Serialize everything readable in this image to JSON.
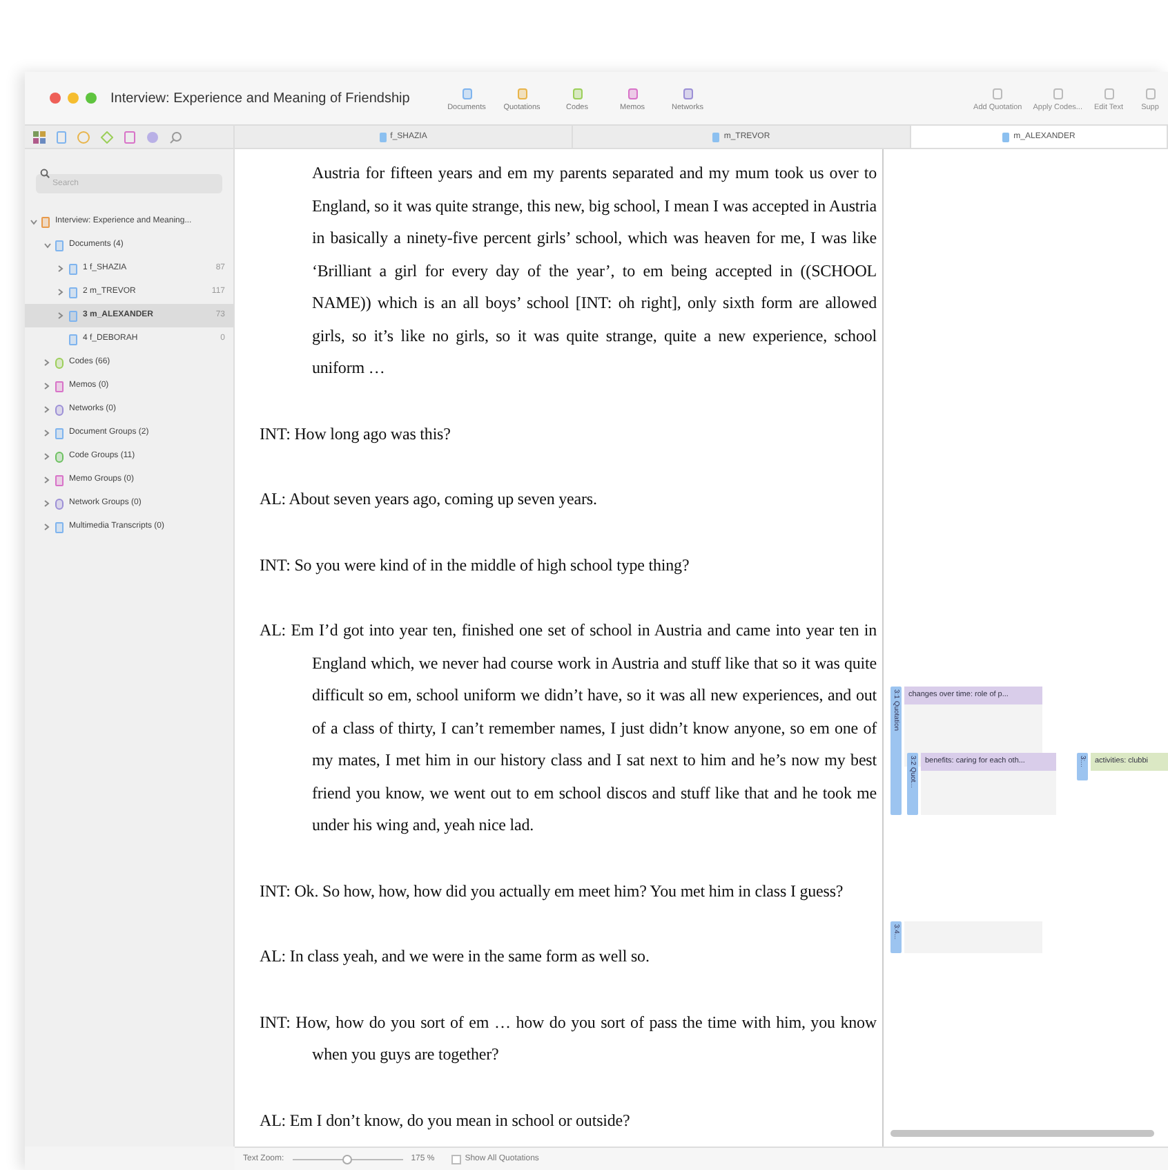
{
  "window": {
    "title": "Interview: Experience and Meaning of Friendship"
  },
  "toolbar": {
    "left": [
      {
        "label": "Documents"
      },
      {
        "label": "Quotations"
      },
      {
        "label": "Codes"
      },
      {
        "label": "Memos"
      },
      {
        "label": "Networks"
      }
    ],
    "right": [
      "Add Quotation",
      "Apply Codes...",
      "Edit Text",
      "Supp"
    ]
  },
  "sidebar": {
    "search": {
      "placeholder": "Search"
    },
    "tree": [
      {
        "label": "Interview: Experience and Meaning...",
        "kind": "project",
        "expanded": true,
        "selected": false,
        "children": [
          {
            "label": "Documents (4)",
            "kind": "document",
            "expanded": true,
            "selected": false,
            "children": [
              {
                "label": "1 f_SHAZIA",
                "kind": "document",
                "count": "87",
                "expanded": false,
                "selected": false
              },
              {
                "label": "2 m_TREVOR",
                "kind": "document",
                "count": "117",
                "expanded": false,
                "selected": false
              },
              {
                "label": "3 m_ALEXANDER",
                "kind": "document",
                "count": "73",
                "expanded": false,
                "selected": true
              },
              {
                "label": "4 f_DEBORAH",
                "kind": "document",
                "count": "0",
                "selected": false
              }
            ]
          },
          {
            "label": "Codes (66)",
            "kind": "code",
            "expanded": false,
            "selected": false
          },
          {
            "label": "Memos (0)",
            "kind": "memo",
            "expanded": false,
            "selected": false
          },
          {
            "label": "Networks (0)",
            "kind": "network",
            "expanded": false,
            "selected": false
          },
          {
            "label": "Document Groups (2)",
            "kind": "document",
            "expanded": false,
            "selected": false
          },
          {
            "label": "Code Groups (11)",
            "kind": "codegroup",
            "expanded": false,
            "selected": false
          },
          {
            "label": "Memo Groups (0)",
            "kind": "memo",
            "expanded": false,
            "selected": false
          },
          {
            "label": "Network Groups (0)",
            "kind": "network",
            "expanded": false,
            "selected": false
          },
          {
            "label": "Multimedia Transcripts (0)",
            "kind": "document",
            "expanded": false,
            "selected": false
          }
        ]
      }
    ]
  },
  "tabs": [
    {
      "label": "f_SHAZIA",
      "selected": false
    },
    {
      "label": "m_TREVOR",
      "selected": false
    },
    {
      "label": "m_ALEXANDER",
      "selected": true
    }
  ],
  "paragraphs": [
    {
      "kind": "continuation",
      "text": "Austria for fifteen years and em my parents separated and my mum took us over to England, so it was quite strange, this new, big school, I mean I was accepted in Austria in basically a ninety-five percent girls’ school, which was heaven for me, I was like ‘Brilliant a girl for every day of the year’, to em being accepted in ((SCHOOL NAME)) which is an all boys’ school [INT: oh right], only sixth form are allowed girls, so it’s like no girls, so it was quite strange, quite a new experience, school uniform …"
    },
    {
      "kind": "turn",
      "text": "INT:  How long ago was this?"
    },
    {
      "kind": "turn",
      "text": "AL: About seven years ago, coming up seven years."
    },
    {
      "kind": "turn",
      "text": "INT:  So you were kind of in the middle of high school type thing?"
    },
    {
      "kind": "turn",
      "text": "AL: Em I’d got into year ten, finished one set of school in Austria and came into year ten in England which, we never had course work in Austria and stuff like that so it was quite difficult so em, school uniform we didn’t have, so it was all new experiences, and out of a class of thirty, I can’t remember names, I just didn’t know anyone, so em one of my mates, I met him in our history class and I sat next to him and he’s now my best friend you know, we went out to em school discos and stuff like that and he took me under his wing and, yeah nice lad."
    },
    {
      "kind": "turn",
      "text": "INT: Ok. So how, how, how did you actually em meet him? You met him in class I guess?"
    },
    {
      "kind": "turn",
      "text": "AL: In class yeah, and we were in the same form as well so."
    },
    {
      "kind": "turn",
      "text": "INT: How, how do you sort of em … how do you sort of pass the time with him, you know when you guys are together?"
    },
    {
      "kind": "turn",
      "text": "AL: Em I don’t know, do you mean in school or outside?"
    }
  ],
  "margin": {
    "quotations": [
      {
        "label": "3:1 Quotation",
        "code": "changes over time: role of p...",
        "color": "#d9cdea"
      },
      {
        "label": "3:2 Quot...",
        "code": "benefits: caring for each oth...",
        "color": "#d9cdea"
      },
      {
        "label": "3:...",
        "code": "activities: clubbi",
        "color": "#dbe8c4"
      },
      {
        "label": "3:4..."
      }
    ]
  },
  "status_bar": {
    "zoom_label": "Text Zoom:",
    "zoom": {
      "level": 0.5
    },
    "zoom_value": "175 %",
    "show_all": {
      "label": "Show All Quotations",
      "checked": false
    }
  }
}
